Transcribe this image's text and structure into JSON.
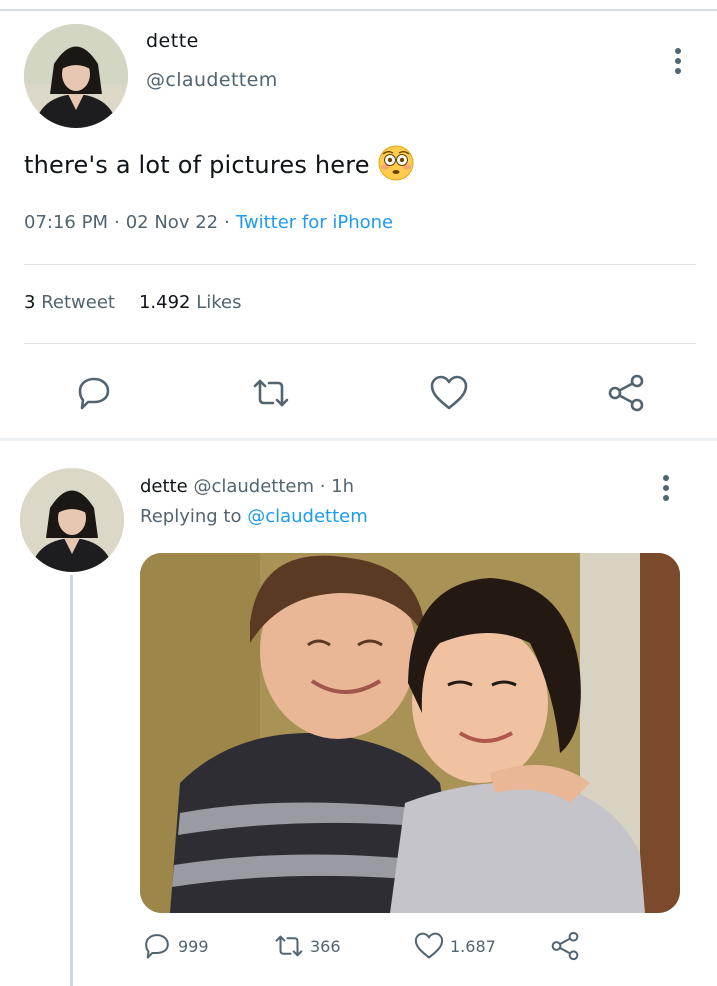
{
  "tweet": {
    "display_name": "dette",
    "handle": "@claudettem",
    "text": "there's a lot of pictures here",
    "emoji": "flushed-face",
    "time": "07:16 PM",
    "date": "02 Nov 22",
    "source": "Twitter for iPhone",
    "retweet_count": "3",
    "retweet_label": "Retweet",
    "like_count": "1.492",
    "like_label": "Likes",
    "actions": [
      "reply-icon",
      "retweet-icon",
      "like-icon",
      "share-icon"
    ]
  },
  "reply": {
    "display_name": "dette",
    "handle": "@claudettem",
    "time_ago": "1h",
    "replying_prefix": "Replying to",
    "replying_to": "@claudettem",
    "reply_count": "999",
    "retweet_count": "366",
    "like_count": "1.687"
  },
  "colors": {
    "text": "#0f1419",
    "secondary": "#536471",
    "link": "#1d9bf0",
    "divider": "#dfe3e7"
  }
}
